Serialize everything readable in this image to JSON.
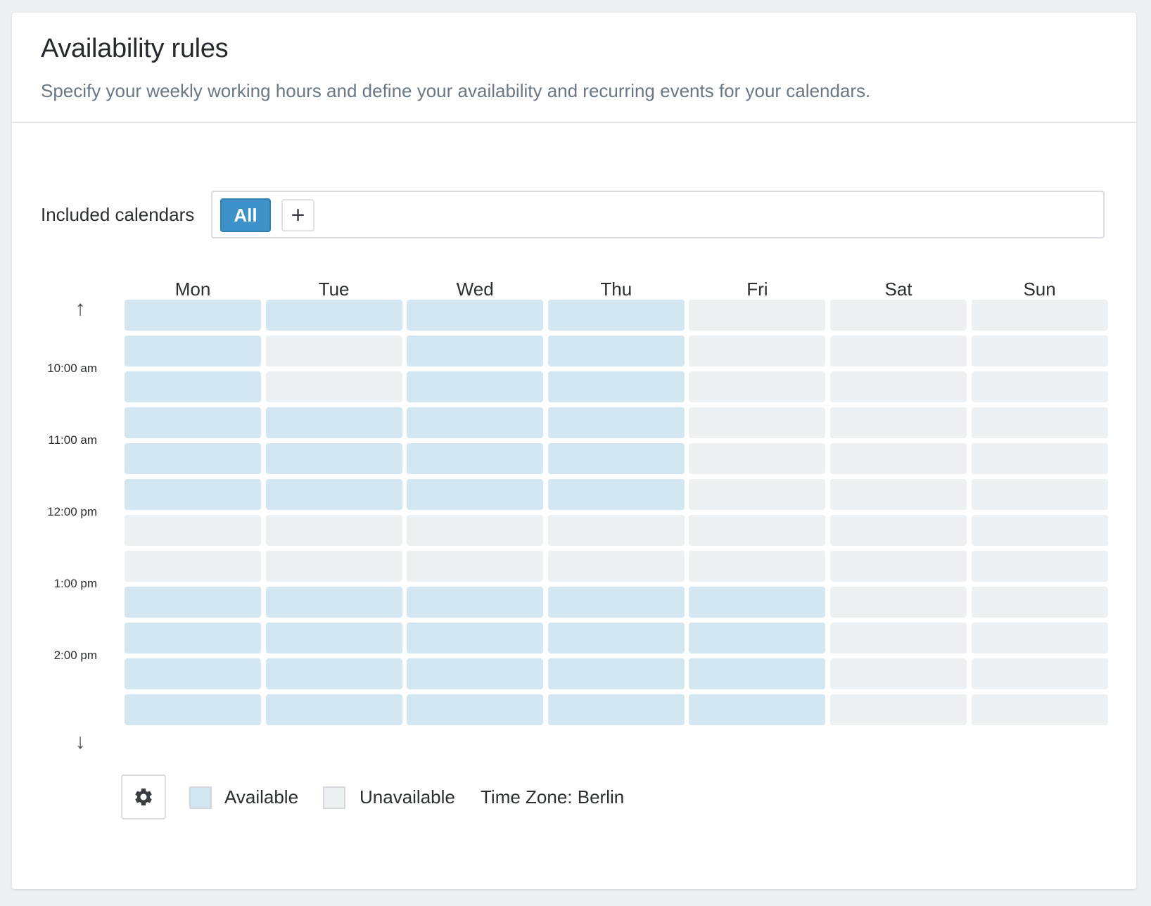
{
  "header": {
    "title": "Availability rules",
    "subtitle": "Specify your weekly working hours and define your availability and recurring events for your calendars."
  },
  "calendars": {
    "label": "Included calendars",
    "selected_chip": "All",
    "add_button": "+"
  },
  "grid": {
    "days": [
      "Mon",
      "Tue",
      "Wed",
      "Thu",
      "Fri",
      "Sat",
      "Sun"
    ],
    "time_labels": [
      "10:00 am",
      "11:00 am",
      "12:00 pm",
      "1:00 pm",
      "2:00 pm"
    ],
    "up_arrow": "↑",
    "down_arrow": "↓",
    "availability": [
      [
        1,
        1,
        1,
        1,
        0,
        0,
        0
      ],
      [
        1,
        0,
        1,
        1,
        0,
        0,
        0
      ],
      [
        1,
        0,
        1,
        1,
        0,
        0,
        0
      ],
      [
        1,
        1,
        1,
        1,
        0,
        0,
        0
      ],
      [
        1,
        1,
        1,
        1,
        0,
        0,
        0
      ],
      [
        1,
        1,
        1,
        1,
        0,
        0,
        0
      ],
      [
        0,
        0,
        0,
        0,
        0,
        0,
        0
      ],
      [
        0,
        0,
        0,
        0,
        0,
        0,
        0
      ],
      [
        1,
        1,
        1,
        1,
        1,
        0,
        0
      ],
      [
        1,
        1,
        1,
        1,
        1,
        0,
        0
      ],
      [
        1,
        1,
        1,
        1,
        1,
        0,
        0
      ],
      [
        1,
        1,
        1,
        1,
        1,
        0,
        0
      ]
    ]
  },
  "legend": {
    "settings_icon": "gear-icon",
    "available_label": "Available",
    "unavailable_label": "Unavailable",
    "timezone_label": "Time Zone: Berlin"
  },
  "colors": {
    "available": "#d3e7f2",
    "unavailable": "#eef1f3",
    "accent": "#3d93c9"
  }
}
